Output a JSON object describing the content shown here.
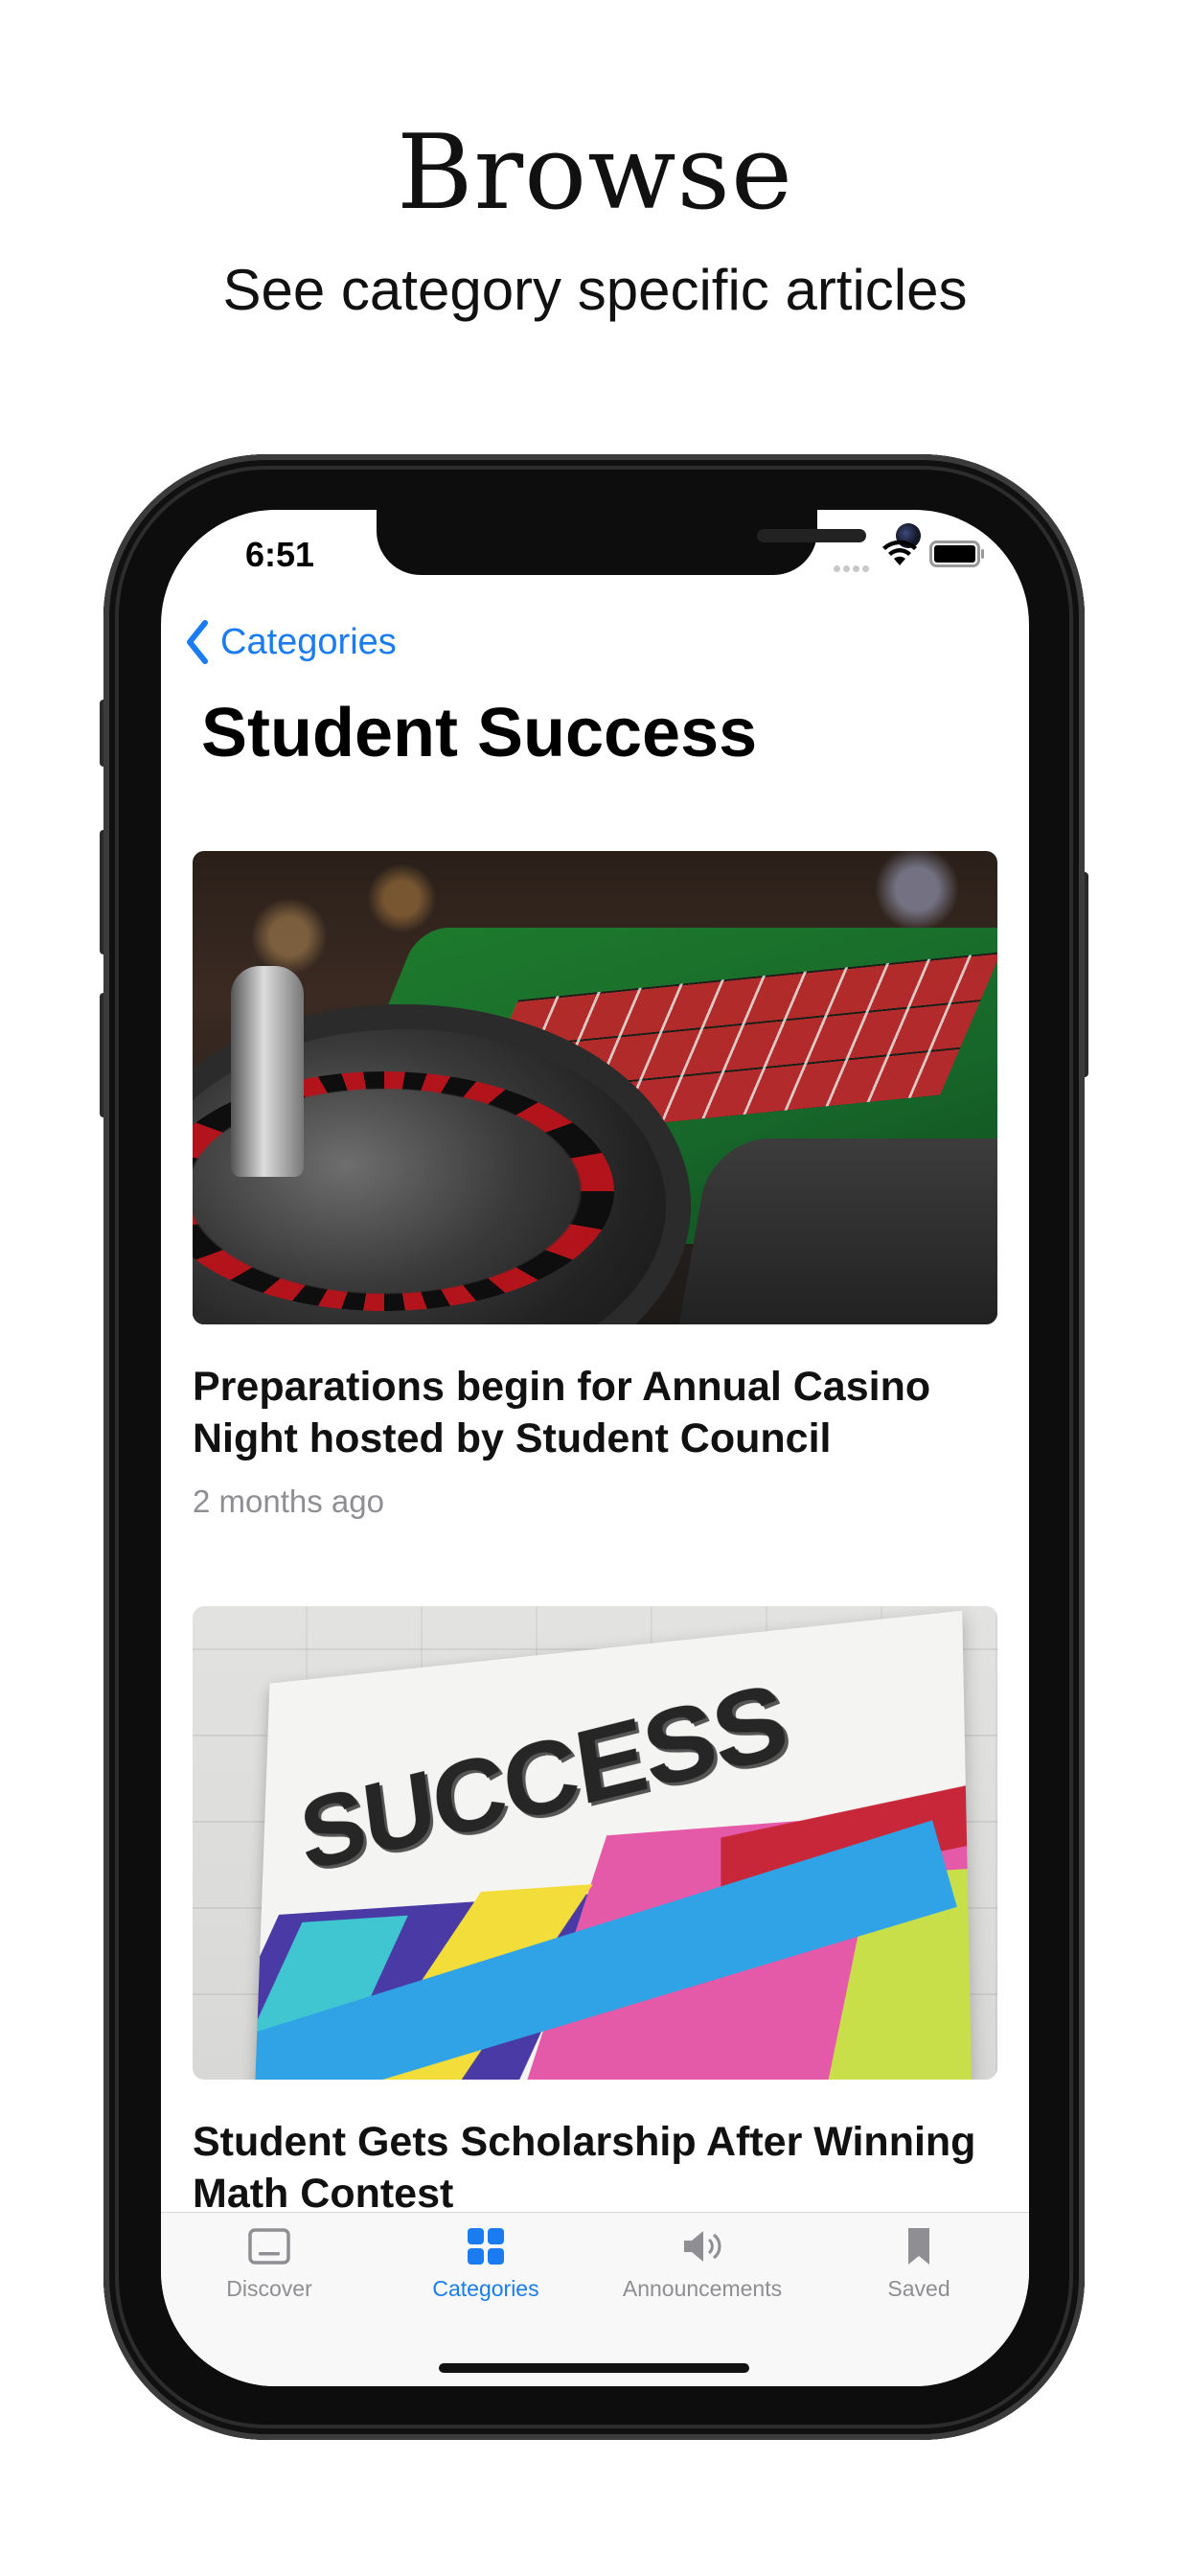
{
  "promo": {
    "title": "Browse",
    "subtitle": "See category specific articles"
  },
  "status_bar": {
    "time": "6:51"
  },
  "nav": {
    "back_label": "Categories",
    "title": "Student Success"
  },
  "articles": [
    {
      "title": "Preparations begin for Annual Casino Night hosted by Student Council",
      "time": "2 months ago",
      "image": "roulette-table-photo"
    },
    {
      "title": "Student Gets Scholarship After Winning Math Contest",
      "image": "success-sign-photo",
      "image_text": "SUCCESS"
    }
  ],
  "tab_bar": {
    "tabs": [
      {
        "label": "Discover",
        "icon": "tray-icon",
        "active": false
      },
      {
        "label": "Categories",
        "icon": "grid-icon",
        "active": true
      },
      {
        "label": "Announcements",
        "icon": "speaker-icon",
        "active": false
      },
      {
        "label": "Saved",
        "icon": "bookmark-icon",
        "active": false
      }
    ]
  },
  "colors": {
    "accent": "#1a7cf0",
    "inactive_tab": "#8e8e93",
    "secondary_text": "#8e8e93"
  }
}
